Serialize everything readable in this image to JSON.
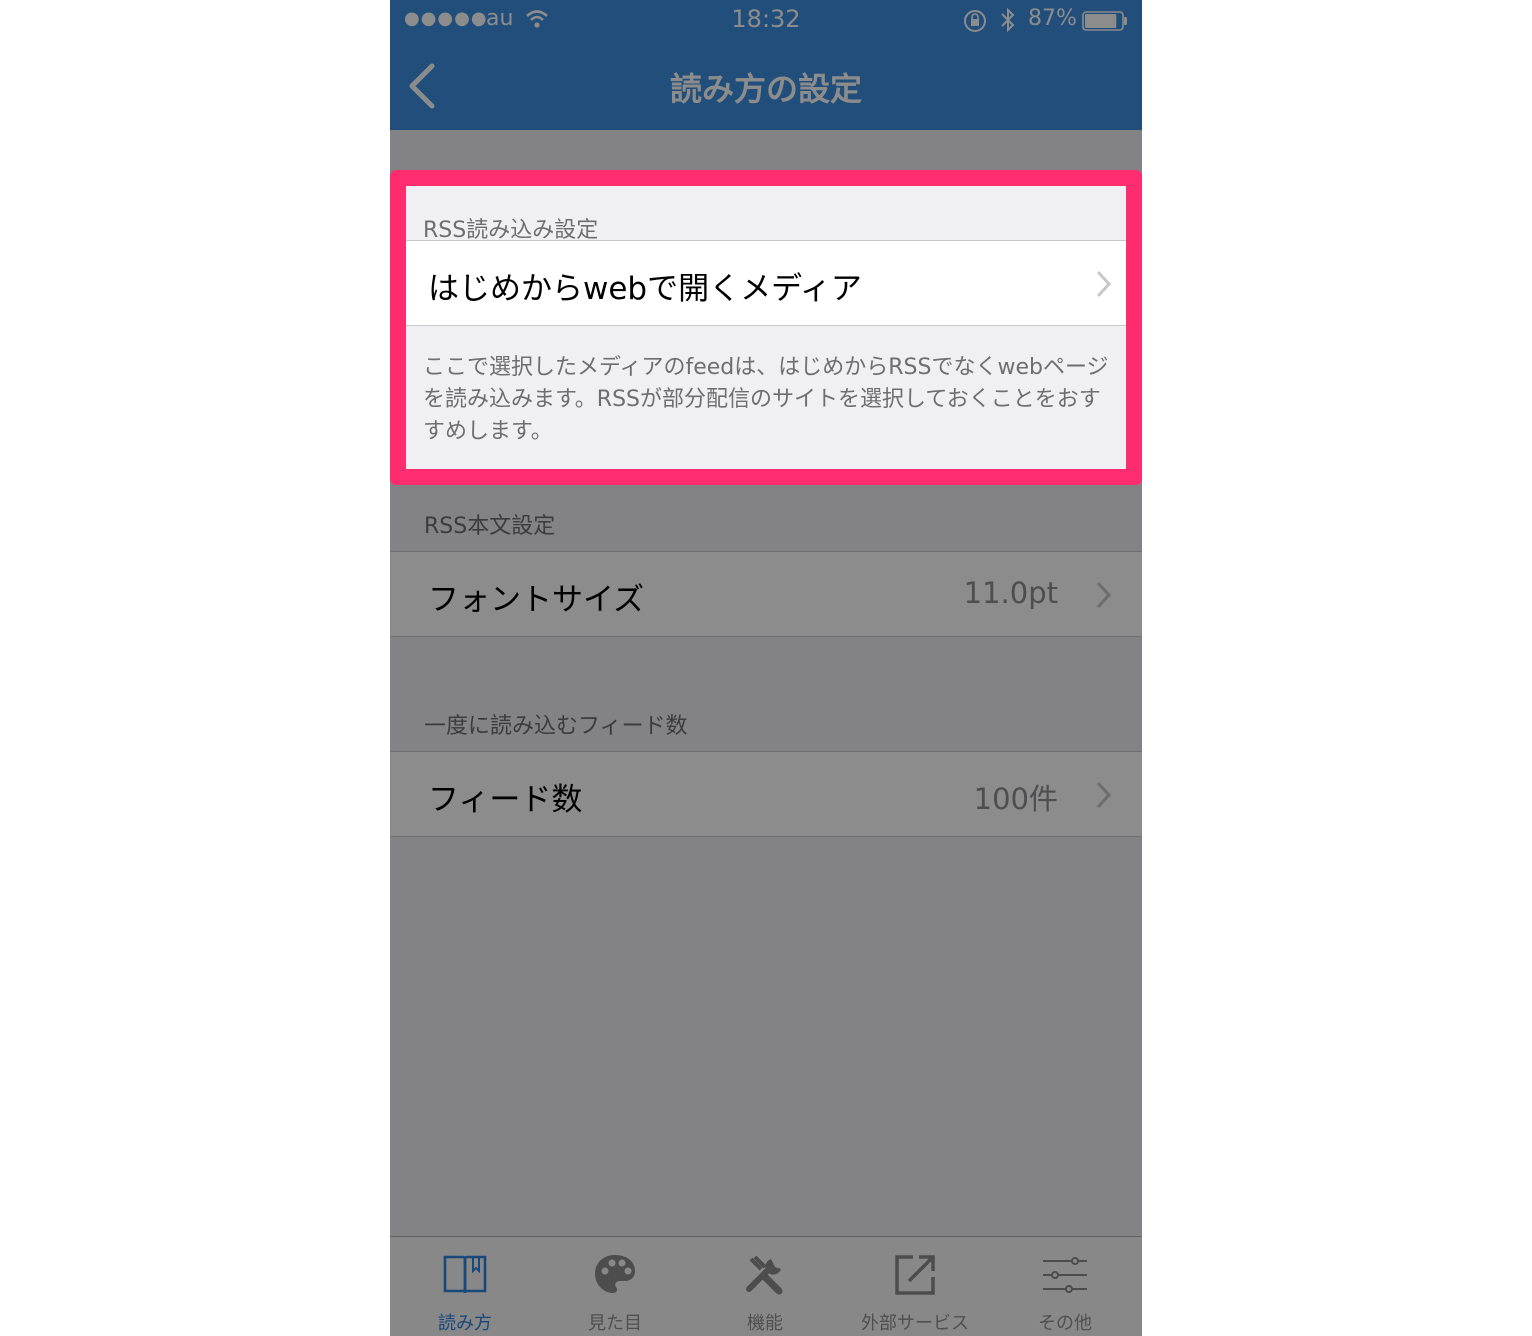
{
  "status_bar": {
    "signal": "●●●●●",
    "carrier": "au",
    "time": "18:32",
    "battery_percent": "87%",
    "battery_level": 0.87
  },
  "nav": {
    "title": "読み方の設定",
    "back_icon": "chevron-left-icon"
  },
  "sections": {
    "rss_load": {
      "header": "RSS読み込み設定",
      "row_label": "はじめからwebで開くメディア",
      "footer": "ここで選択したメディアのfeedは、はじめからRSSでなくwebページを読み込みます。RSSが部分配信のサイトを選択しておくことをおすすめします。"
    },
    "rss_body": {
      "header": "RSS本文設定",
      "row_label": "フォントサイズ",
      "row_value": "11.0pt"
    },
    "feed_count": {
      "header": "一度に読み込むフィード数",
      "row_label": "フィード数",
      "row_value": "100件"
    }
  },
  "tabs": [
    {
      "label": "読み方",
      "icon": "book-icon",
      "active": true
    },
    {
      "label": "見た目",
      "icon": "palette-icon",
      "active": false
    },
    {
      "label": "機能",
      "icon": "tools-icon",
      "active": false
    },
    {
      "label": "外部サービス",
      "icon": "external-link-icon",
      "active": false
    },
    {
      "label": "その他",
      "icon": "sliders-icon",
      "active": false
    }
  ],
  "colors": {
    "nav_blue": "#3c8fe1",
    "highlight": "#ff2c6f",
    "tab_active": "#2f84de"
  }
}
